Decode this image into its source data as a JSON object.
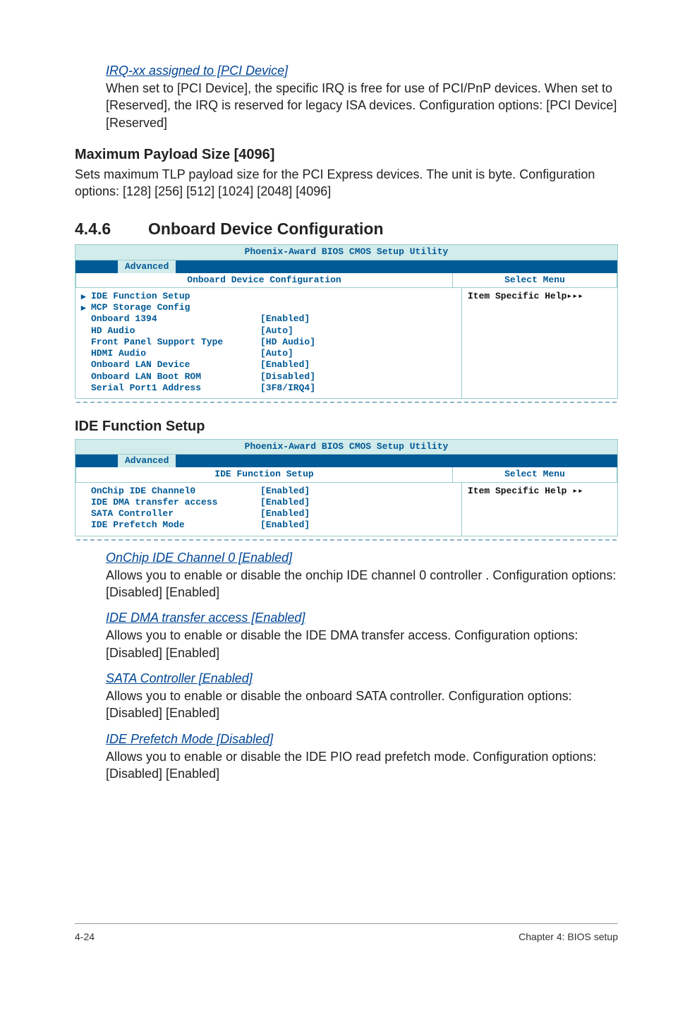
{
  "intro": {
    "heading": "IRQ-xx assigned to [PCI Device]",
    "text": "When set to [PCI Device], the specific IRQ is free for use of PCI/PnP devices. When set to [Reserved], the IRQ is reserved for legacy ISA devices. Configuration options: [PCI Device] [Reserved]"
  },
  "maxPayload": {
    "heading": "Maximum Payload Size [4096]",
    "text": "Sets maximum TLP payload size for the PCI Express devices. The unit is byte. Configuration options: [128] [256] [512] [1024] [2048] [4096]"
  },
  "section": {
    "num": "4.4.6",
    "title": "Onboard Device Configuration"
  },
  "bios1": {
    "title": "Phoenix-Award BIOS CMOS Setup Utility",
    "tab": "Advanced",
    "subLeft": "Onboard Device Configuration",
    "subRight": "Select Menu",
    "help": "Item Specific Help▸▸▸",
    "rows": [
      {
        "arrow": "▸",
        "label": "IDE Function Setup",
        "value": ""
      },
      {
        "arrow": "▸",
        "label": "MCP Storage Config",
        "value": ""
      },
      {
        "arrow": "",
        "label": "Onboard 1394",
        "value": "[Enabled]"
      },
      {
        "arrow": "",
        "label": "HD Audio",
        "value": "[Auto]"
      },
      {
        "arrow": "",
        "label": "Front Panel Support Type",
        "value": "[HD Audio]"
      },
      {
        "arrow": "",
        "label": "HDMI Audio",
        "value": "[Auto]"
      },
      {
        "arrow": "",
        "label": "Onboard LAN Device",
        "value": "[Enabled]"
      },
      {
        "arrow": "",
        "label": "Onboard LAN Boot ROM",
        "value": "[Disabled]"
      },
      {
        "arrow": "",
        "label": "Serial Port1 Address",
        "value": "[3F8/IRQ4]"
      }
    ]
  },
  "ideSetup": {
    "heading": "IDE Function Setup"
  },
  "bios2": {
    "title": "Phoenix-Award BIOS CMOS Setup Utility",
    "tab": "Advanced",
    "subLeft": "IDE Function Setup",
    "subRight": "Select Menu",
    "help": "Item Specific Help ▸▸",
    "rows": [
      {
        "arrow": "",
        "label": "OnChip IDE Channel0",
        "value": "[Enabled]"
      },
      {
        "arrow": "",
        "label": "IDE DMA transfer access",
        "value": "[Enabled]"
      },
      {
        "arrow": "",
        "label": "SATA Controller",
        "value": "[Enabled]"
      },
      {
        "arrow": "",
        "label": "IDE Prefetch Mode",
        "value": "[Enabled]"
      }
    ]
  },
  "descs": [
    {
      "title": "OnChip IDE Channel 0 [Enabled]",
      "text": "Allows you to enable or disable the onchip IDE channel 0 controller . Configuration options: [Disabled] [Enabled]"
    },
    {
      "title": "IDE DMA transfer access [Enabled]",
      "text": "Allows you to enable or disable the IDE DMA transfer access. Configuration options: [Disabled] [Enabled]"
    },
    {
      "title": "SATA Controller [Enabled]",
      "text": "Allows you to enable or disable the onboard SATA controller. Configuration options: [Disabled] [Enabled]"
    },
    {
      "title": "IDE Prefetch Mode [Disabled]",
      "text": "Allows you to enable or disable the IDE PIO read prefetch mode. Configuration options: [Disabled] [Enabled]"
    }
  ],
  "footer": {
    "left": "4-24",
    "right": "Chapter 4: BIOS setup"
  }
}
